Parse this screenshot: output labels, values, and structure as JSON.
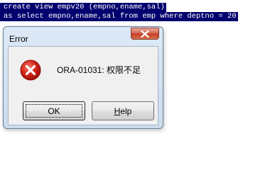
{
  "editor": {
    "lines": [
      "create view empv20 (empno,ename,sal)",
      "as select empno,ename,sal from emp where deptno = 20"
    ]
  },
  "dialog": {
    "title": "Error",
    "message": "ORA-01031: 权限不足",
    "icon": "error-icon",
    "buttons": {
      "ok_label": "OK",
      "help_accel": "H",
      "help_rest": "elp"
    }
  },
  "colors": {
    "selection_bg": "#00006e",
    "close_red": "#c43b23",
    "dialog_frame": "#cbdcee"
  }
}
